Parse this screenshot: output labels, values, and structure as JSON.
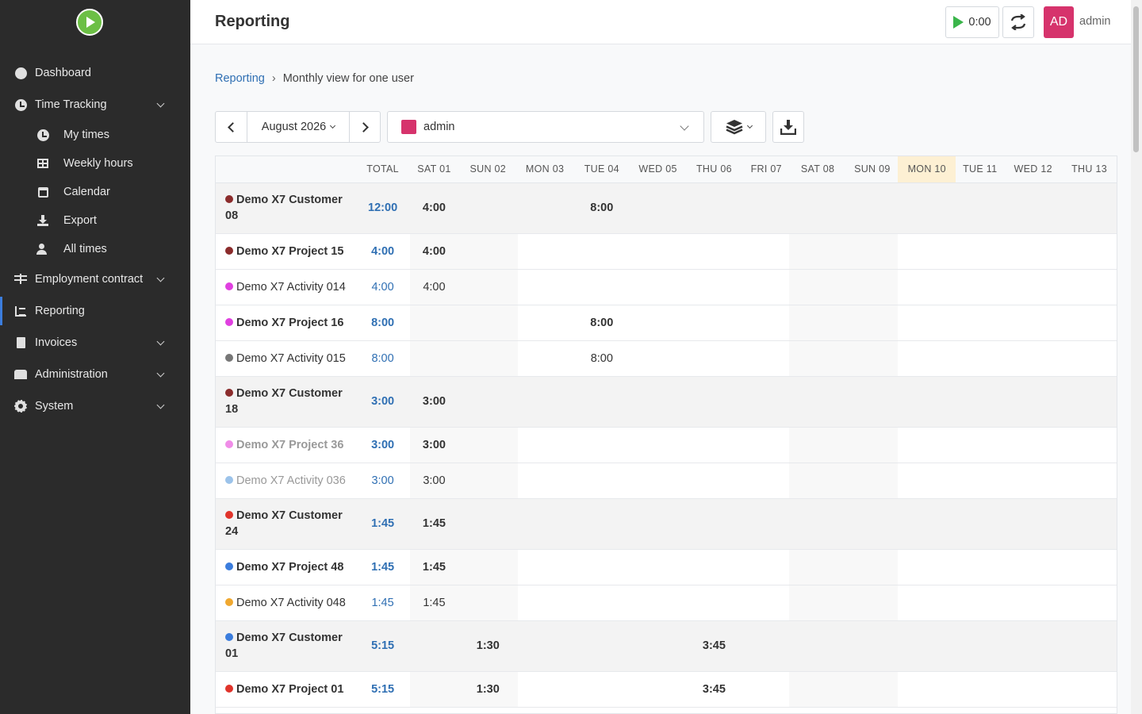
{
  "app": {
    "page_title": "Reporting",
    "user_initials": "AD",
    "user_name": "admin",
    "timer": "0:00",
    "accent": "#3b7ddd",
    "brand": "#6cbf45"
  },
  "sidebar": {
    "items": [
      {
        "label": "Dashboard",
        "icon": "dashboard-icon"
      },
      {
        "label": "Time Tracking",
        "icon": "clock-icon"
      },
      {
        "label": "My times",
        "icon": "clock-icon"
      },
      {
        "label": "Weekly hours",
        "icon": "table-icon"
      },
      {
        "label": "Calendar",
        "icon": "calendar-icon"
      },
      {
        "label": "Export",
        "icon": "download-icon"
      },
      {
        "label": "All times",
        "icon": "users-icon"
      },
      {
        "label": "Employment contract",
        "icon": "scale-icon"
      },
      {
        "label": "Reporting",
        "icon": "chart-icon"
      },
      {
        "label": "Invoices",
        "icon": "file-icon"
      },
      {
        "label": "Administration",
        "icon": "building-icon"
      },
      {
        "label": "System",
        "icon": "gear-icon"
      }
    ]
  },
  "breadcrumb": {
    "root": "Reporting",
    "separator": "›",
    "current": "Monthly view for one user"
  },
  "toolbar": {
    "month": "August 2026",
    "user": "admin",
    "user_color": "#d6336c"
  },
  "table": {
    "headers": [
      "",
      "TOTAL",
      "SAT 01",
      "SUN 02",
      "MON 03",
      "TUE 04",
      "WED 05",
      "THU 06",
      "FRI 07",
      "SAT 08",
      "SUN 09",
      "MON 10",
      "TUE 11",
      "WED 12",
      "THU 13"
    ],
    "today_index": 11,
    "rows": [
      {
        "type": "cust",
        "name": "Demo X7 Customer 08",
        "color": "#8b2c2c",
        "total": "12:00",
        "cells": [
          "4:00",
          "",
          "",
          "8:00",
          "",
          "",
          "",
          "",
          "",
          "",
          "",
          "",
          ""
        ]
      },
      {
        "type": "proj",
        "name": "Demo X7 Project 15",
        "color": "#8b2c2c",
        "total": "4:00",
        "cells": [
          "4:00",
          "",
          "",
          "",
          "",
          "",
          "",
          "",
          "",
          "",
          "",
          "",
          ""
        ]
      },
      {
        "type": "act",
        "name": "Demo X7 Activity 014",
        "color": "#e040e0",
        "total": "4:00",
        "cells": [
          "4:00",
          "",
          "",
          "",
          "",
          "",
          "",
          "",
          "",
          "",
          "",
          "",
          ""
        ]
      },
      {
        "type": "proj",
        "name": "Demo X7 Project 16",
        "color": "#e040e0",
        "total": "8:00",
        "cells": [
          "",
          "",
          "",
          "8:00",
          "",
          "",
          "",
          "",
          "",
          "",
          "",
          "",
          ""
        ]
      },
      {
        "type": "act",
        "name": "Demo X7 Activity 015",
        "color": "#777777",
        "total": "8:00",
        "cells": [
          "",
          "",
          "",
          "8:00",
          "",
          "",
          "",
          "",
          "",
          "",
          "",
          "",
          ""
        ]
      },
      {
        "type": "cust",
        "name": "Demo X7 Customer 18",
        "color": "#8b2c2c",
        "total": "3:00",
        "cells": [
          "3:00",
          "",
          "",
          "",
          "",
          "",
          "",
          "",
          "",
          "",
          "",
          "",
          ""
        ]
      },
      {
        "type": "proj muted",
        "name": "Demo X7 Project 36",
        "color": "#f08de8",
        "total": "3:00",
        "cells": [
          "3:00",
          "",
          "",
          "",
          "",
          "",
          "",
          "",
          "",
          "",
          "",
          "",
          ""
        ]
      },
      {
        "type": "act muted",
        "name": "Demo X7 Activity 036",
        "color": "#9cc3ea",
        "total": "3:00",
        "cells": [
          "3:00",
          "",
          "",
          "",
          "",
          "",
          "",
          "",
          "",
          "",
          "",
          "",
          ""
        ]
      },
      {
        "type": "cust",
        "name": "Demo X7 Customer 24",
        "color": "#e0342b",
        "total": "1:45",
        "cells": [
          "1:45",
          "",
          "",
          "",
          "",
          "",
          "",
          "",
          "",
          "",
          "",
          "",
          ""
        ]
      },
      {
        "type": "proj",
        "name": "Demo X7 Project 48",
        "color": "#3b7ddd",
        "total": "1:45",
        "cells": [
          "1:45",
          "",
          "",
          "",
          "",
          "",
          "",
          "",
          "",
          "",
          "",
          "",
          ""
        ]
      },
      {
        "type": "act",
        "name": "Demo X7 Activity 048",
        "color": "#f0a830",
        "total": "1:45",
        "cells": [
          "1:45",
          "",
          "",
          "",
          "",
          "",
          "",
          "",
          "",
          "",
          "",
          "",
          ""
        ]
      },
      {
        "type": "cust",
        "name": "Demo X7 Customer 01",
        "color": "#3b7ddd",
        "total": "5:15",
        "cells": [
          "",
          "1:30",
          "",
          "",
          "",
          "3:45",
          "",
          "",
          "",
          "",
          "",
          "",
          ""
        ]
      },
      {
        "type": "proj",
        "name": "Demo X7 Project 01",
        "color": "#e0342b",
        "total": "5:15",
        "cells": [
          "",
          "1:30",
          "",
          "",
          "",
          "3:45",
          "",
          "",
          "",
          "",
          "",
          "",
          ""
        ]
      }
    ]
  }
}
